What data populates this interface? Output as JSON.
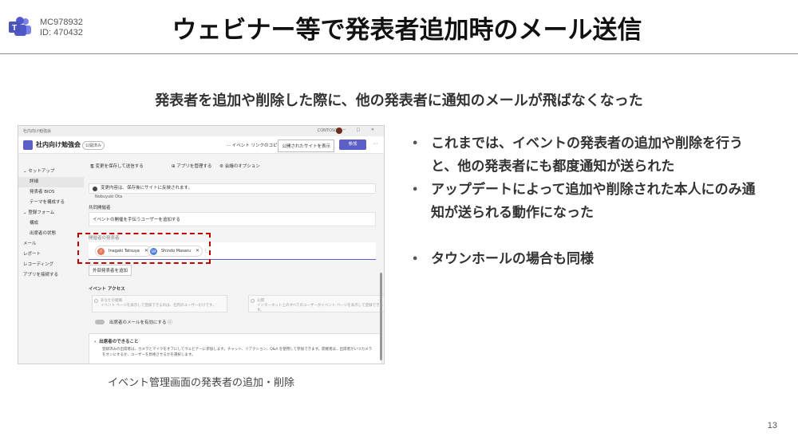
{
  "header": {
    "mc_line1": "MC978932",
    "mc_line2": "ID: 470432",
    "title": "ウェビナー等で発表者追加時のメール送信"
  },
  "subtitle": "発表者を追加や削除した際に、他の発表者に通知のメールが飛ばなくなった",
  "screenshot": {
    "window_title": "社内向け勉強会",
    "org": "CONTOSO",
    "app_name": "社内向け勉強会",
    "app_badge": "公開済み",
    "copy_link": "⋯ イベント リンクのコピー",
    "publish_btn": "公開されたサイトを表示",
    "join_btn": "参加",
    "toolbar": {
      "save": "変更を保存して送信する",
      "apps": "アプリを管理する",
      "options": "会議のオプション"
    },
    "sidebar": [
      {
        "label": "セットアップ",
        "sub": false
      },
      {
        "label": "詳細",
        "sub": true
      },
      {
        "label": "発表者 BIOS",
        "sub": true
      },
      {
        "label": "テーマを構成する",
        "sub": true
      },
      {
        "label": "登録フォーム",
        "sub": false
      },
      {
        "label": "構成",
        "sub": true
      },
      {
        "label": "出席者の状態",
        "sub": true
      },
      {
        "label": "メール",
        "sub": false
      },
      {
        "label": "レポート",
        "sub": false
      },
      {
        "label": "レコーディング",
        "sub": false
      },
      {
        "label": "アプリを接続する",
        "sub": false
      }
    ],
    "banner": "変更内容は、保存後にサイトに反映されます。",
    "cut_text": "Nobuyuki Ota",
    "co_organizer_label": "共同開催者",
    "co_organizer_value": "イベントの開催を手伝うユーザーを追加する",
    "presenter_label": "開催者の発表者",
    "chips": [
      {
        "initials": "IT",
        "name": "Inagaki Tatsuya",
        "color": "#e8735a"
      },
      {
        "initials": "SM",
        "name": "Shindo Masaru",
        "color": "#4f7fd8"
      }
    ],
    "ext_btn": "外部発表者を追加",
    "access_label": "イベント アクセス",
    "radio1_title": "あなたの組織",
    "radio1_desc": "イベント ページを表示して登録できるのは、社内のユーザーだけです。",
    "radio2_title": "公開",
    "radio2_desc": "インターネット上のすべてのユーザーがイベント ページを表示して登録できます。",
    "toggle_label": "出席者のメールを有効にする",
    "expander_title": "出席者のできること",
    "expander_desc": "登録済みの出席者は、カメラとマイクをオフにしてウェビナーに参加します。チャット、リアクション、Q&A を使用して参加できます。開催者は、出席者がいつカメラをオンにするか、ユーザーを昇格させるかを選択します。"
  },
  "caption": "イベント管理画面の発表者の追加・削除",
  "bullets": [
    "これまでは、イベントの発表者の追加や削除を行うと、他の発表者にも都度通知が送られた",
    "アップデートによって追加や削除された本人にのみ通知が送られる動作になった",
    "タウンホールの場合も同様"
  ],
  "page_number": "13"
}
